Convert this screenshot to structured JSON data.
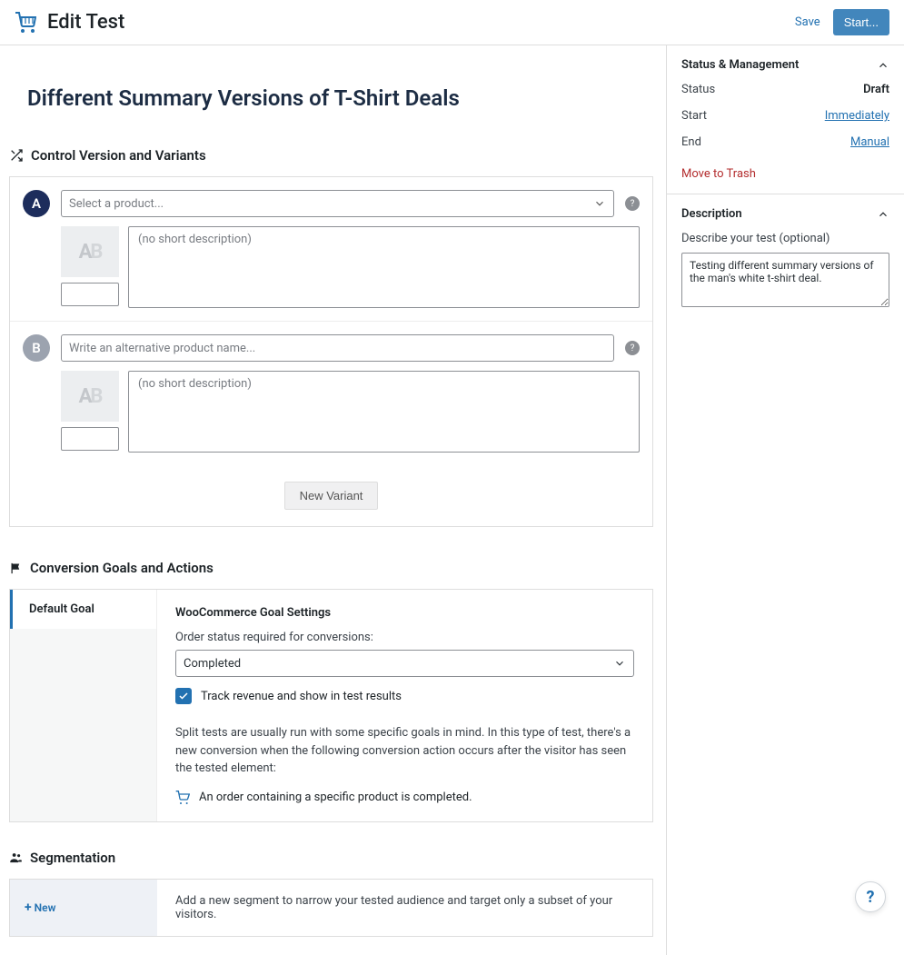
{
  "header": {
    "title": "Edit Test",
    "save_label": "Save",
    "start_label": "Start..."
  },
  "test": {
    "title": "Different Summary Versions of T-Shirt Deals"
  },
  "variants": {
    "heading": "Control Version and Variants",
    "a": {
      "letter": "A",
      "select_placeholder": "Select a product...",
      "desc_placeholder": "(no short description)"
    },
    "b": {
      "letter": "B",
      "name_placeholder": "Write an alternative product name...",
      "desc_placeholder": "(no short description)"
    },
    "new_label": "New Variant"
  },
  "goals": {
    "heading": "Conversion Goals and Actions",
    "tab": "Default Goal",
    "settings_title": "WooCommerce Goal Settings",
    "order_status_label": "Order status required for conversions:",
    "order_status_value": "Completed",
    "track_revenue": "Track revenue and show in test results",
    "explain": "Split tests are usually run with some specific goals in mind. In this type of test, there's a new conversion when the following conversion action occurs after the visitor has seen the tested element:",
    "action": "An order containing a specific product is completed."
  },
  "segmentation": {
    "heading": "Segmentation",
    "new_label": "New",
    "description": "Add a new segment to narrow your tested audience and target only a subset of your visitors."
  },
  "sidebar": {
    "status_heading": "Status & Management",
    "status_label": "Status",
    "status_value": "Draft",
    "start_label": "Start",
    "start_value": "Immediately",
    "end_label": "End",
    "end_value": "Manual",
    "trash": "Move to Trash",
    "desc_heading": "Description",
    "desc_label": "Describe your test (optional)",
    "desc_value": "Testing different summary versions of the man's white t-shirt deal."
  },
  "help_glyph": "?"
}
